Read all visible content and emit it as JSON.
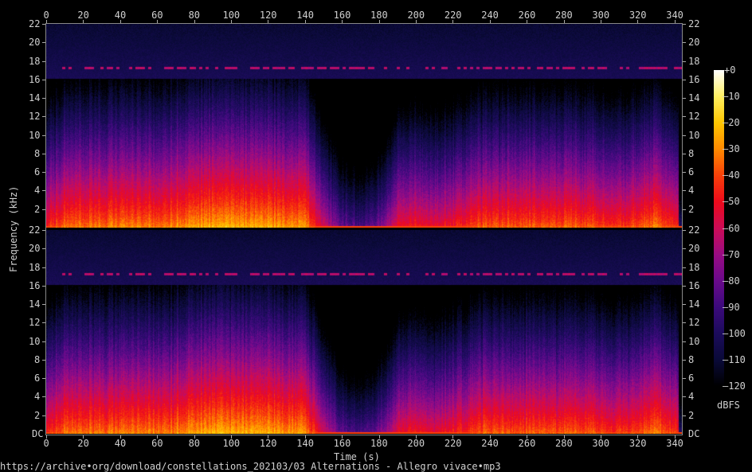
{
  "chart_data": {
    "type": "heatmap",
    "subtype": "spectrogram",
    "channels": 2,
    "xlabel": "Time (s)",
    "ylabel": "Frequency (kHz)",
    "colorbar_label": "dBFS",
    "xlim": [
      0,
      344
    ],
    "ylim_khz": [
      0,
      22
    ],
    "x_ticks": [
      0,
      20,
      40,
      60,
      80,
      100,
      120,
      140,
      160,
      180,
      200,
      220,
      240,
      260,
      280,
      300,
      320,
      340
    ],
    "y_ticks": [
      "2",
      "4",
      "6",
      "8",
      "10",
      "12",
      "14",
      "16",
      "18",
      "20",
      "22"
    ],
    "y_zero_label": "DC",
    "colorbar_ticks": [
      "+0",
      "-10",
      "-20",
      "-30",
      "-40",
      "-50",
      "-60",
      "-70",
      "-80",
      "-90",
      "-100",
      "-110",
      "-120"
    ],
    "color_range_db": [
      -120,
      0
    ],
    "colormap": [
      "#000000",
      "#0a0a38",
      "#1c0c5c",
      "#3c0a7c",
      "#6a0a8c",
      "#9a0c84",
      "#cc0c58",
      "#ee0a1c",
      "#f8400a",
      "#ff8a00",
      "#ffc600",
      "#fff060",
      "#ffffff"
    ],
    "low_band_level_db_every_10s": [
      -45,
      -30,
      -30,
      -32,
      -28,
      -28,
      -30,
      -28,
      -25,
      -22,
      -22,
      -22,
      -22,
      -25,
      -25,
      -55,
      -80,
      -85,
      -75,
      -50,
      -45,
      -50,
      -45,
      -38,
      -35,
      -35,
      -35,
      -35,
      -35,
      -35,
      -38,
      -40,
      -35,
      -28,
      -40
    ],
    "lowpass_cutoff_khz": 16,
    "tone_line_khz": 17.2
  },
  "footer": {
    "source": "https://archive•org/download/constellations_202103/03 Alternations - Allegro vivace•mp3"
  }
}
